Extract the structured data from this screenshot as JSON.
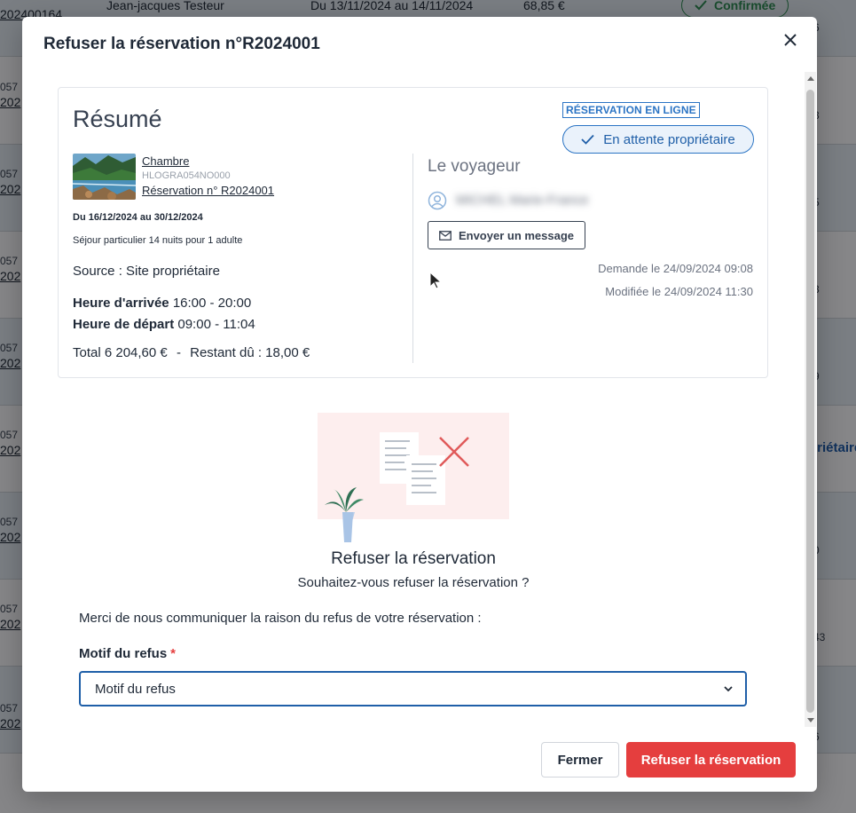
{
  "background": {
    "top_row": {
      "id": "202400164",
      "name": "Jean-jacques Testeur",
      "dates": "Du 13/11/2024 au 14/11/2024",
      "amount": "68,85 €",
      "status": "Confirmée",
      "right": "6"
    },
    "rows": [
      {
        "id1": "057",
        "id2": "202",
        "right": "3"
      },
      {
        "id1": "057",
        "id2": "202",
        "right": "5"
      },
      {
        "id1": "057",
        "id2": "202",
        "right": "3"
      },
      {
        "id1": "057",
        "id2": "202",
        "right": "9"
      },
      {
        "id1": "057",
        "id2": "202",
        "right": ""
      },
      {
        "id1": "057",
        "id2": "202",
        "right": "0"
      },
      {
        "id1": "057",
        "id2": "202",
        "right": "43"
      },
      {
        "id1": "057",
        "id2": "202",
        "right": "6"
      }
    ],
    "owner_tag": "priétaire"
  },
  "modal": {
    "title": "Refuser la réservation n°R2024001",
    "summary": {
      "title": "Résumé",
      "online_tag": "RÉSERVATION EN LIGNE",
      "status": "En attente propriétaire",
      "room_label": "Chambre",
      "room_code": "HLOGRA054NO000",
      "reservation_link": "Réservation n° R2024001",
      "dates": "Du 16/12/2024 au 30/12/2024",
      "stay": "Séjour particulier 14 nuits pour 1 adulte",
      "source": "Source : Site propriétaire",
      "arrival_label": "Heure d'arrivée",
      "arrival_value": "16:00 - 20:00",
      "departure_label": "Heure de départ",
      "departure_value": "09:00 - 11:04",
      "total": "Total 6 204,60 €",
      "separator": "-",
      "remaining": "Restant dû : 18,00 €"
    },
    "traveler": {
      "title": "Le voyageur",
      "name": "MICHEL Marie-France",
      "message_button": "Envoyer un message",
      "requested": "Demande le 24/09/2024 09:08",
      "modified": "Modifiée le 24/09/2024 11:30"
    },
    "refuse": {
      "title": "Refuser la réservation",
      "question": "Souhaitez-vous refuser la réservation ?",
      "intro": "Merci de nous communiquer la raison du refus de votre réservation :",
      "reason_label": "Motif du refus",
      "required_mark": "*",
      "reason_placeholder": "Motif du refus"
    },
    "footer": {
      "close_label": "Fermer",
      "refuse_label": "Refuser la réservation"
    }
  },
  "colors": {
    "primary": "#1f5fa8",
    "danger": "#e53e3e",
    "online_tag": "#2b74c4",
    "confirmed": "#2f8a55"
  }
}
